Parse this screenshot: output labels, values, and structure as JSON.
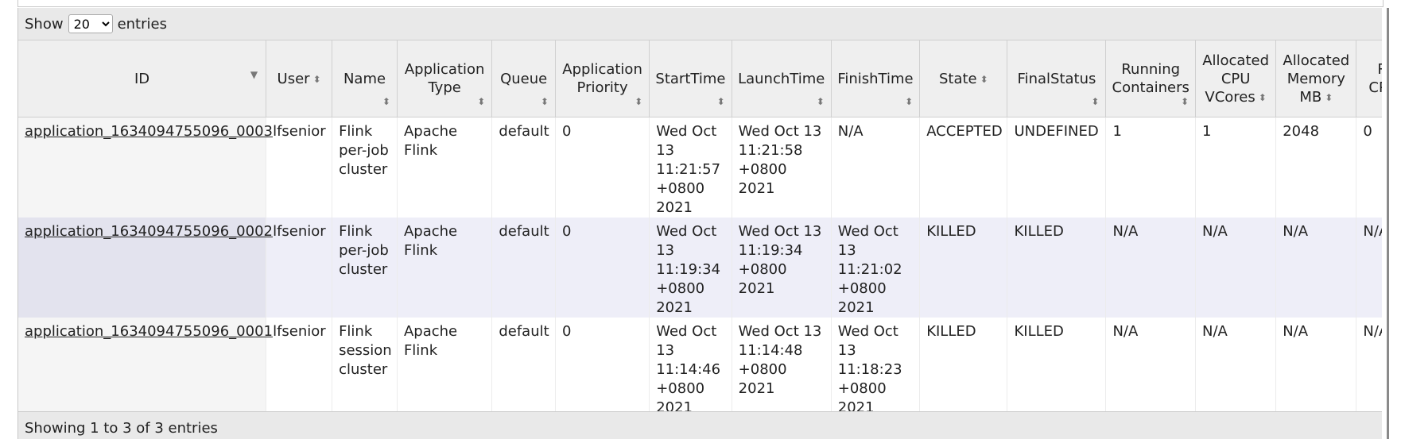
{
  "controls": {
    "show_label": "Show",
    "entries_label": "entries",
    "page_size_selected": "20",
    "page_size_options": [
      "20"
    ],
    "info_text": "Showing 1 to 3 of 3 entries"
  },
  "columns": [
    {
      "key": "id",
      "label": "ID"
    },
    {
      "key": "user",
      "label": "User"
    },
    {
      "key": "name",
      "label": "Name"
    },
    {
      "key": "app_type",
      "label": "Application Type"
    },
    {
      "key": "queue",
      "label": "Queue"
    },
    {
      "key": "priority",
      "label": "Application Priority"
    },
    {
      "key": "start",
      "label": "StartTime"
    },
    {
      "key": "launch",
      "label": "LaunchTime"
    },
    {
      "key": "finish",
      "label": "FinishTime"
    },
    {
      "key": "state",
      "label": "State"
    },
    {
      "key": "final",
      "label": "FinalStatus"
    },
    {
      "key": "containers",
      "label": "Running Containers"
    },
    {
      "key": "vcores",
      "label": "Allocated CPU VCores"
    },
    {
      "key": "memory",
      "label": "Allocated Memory MB"
    },
    {
      "key": "reserved",
      "label": "Reserved CPU VCores"
    }
  ],
  "rows": [
    {
      "id": "application_1634094755096_0003",
      "user": "lfsenior",
      "name": "Flink per-job cluster",
      "app_type": "Apache Flink",
      "queue": "default",
      "priority": "0",
      "start": "Wed Oct 13 11:21:57 +0800 2021",
      "launch": "Wed Oct 13 11:21:58 +0800 2021",
      "finish": "N/A",
      "state": "ACCEPTED",
      "final": "UNDEFINED",
      "containers": "1",
      "vcores": "1",
      "memory": "2048",
      "reserved": "0"
    },
    {
      "id": "application_1634094755096_0002",
      "user": "lfsenior",
      "name": "Flink per-job cluster",
      "app_type": "Apache Flink",
      "queue": "default",
      "priority": "0",
      "start": "Wed Oct 13 11:19:34 +0800 2021",
      "launch": "Wed Oct 13 11:19:34 +0800 2021",
      "finish": "Wed Oct 13 11:21:02 +0800 2021",
      "state": "KILLED",
      "final": "KILLED",
      "containers": "N/A",
      "vcores": "N/A",
      "memory": "N/A",
      "reserved": "N/A"
    },
    {
      "id": "application_1634094755096_0001",
      "user": "lfsenior",
      "name": "Flink session cluster",
      "app_type": "Apache Flink",
      "queue": "default",
      "priority": "0",
      "start": "Wed Oct 13 11:14:46 +0800 2021",
      "launch": "Wed Oct 13 11:14:48 +0800 2021",
      "finish": "Wed Oct 13 11:18:23 +0800 2021",
      "state": "KILLED",
      "final": "KILLED",
      "containers": "N/A",
      "vcores": "N/A",
      "memory": "N/A",
      "reserved": "N/A"
    }
  ]
}
